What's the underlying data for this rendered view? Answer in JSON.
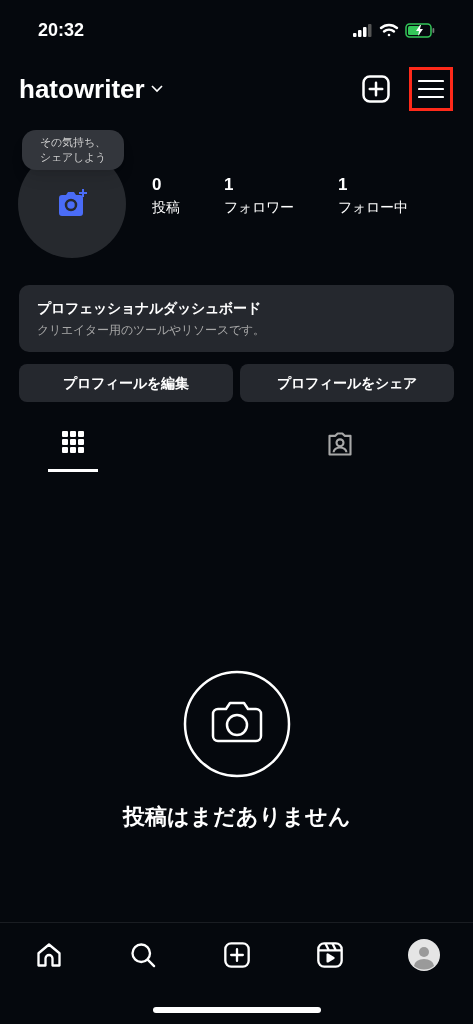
{
  "status_bar": {
    "time": "20:32"
  },
  "header": {
    "username": "hatowriter",
    "menu_highlighted": true
  },
  "profile": {
    "tooltip": [
      "その気持ち、",
      "シェアしよう"
    ],
    "stats": [
      {
        "value": "0",
        "label": "投稿"
      },
      {
        "value": "1",
        "label": "フォロワー"
      },
      {
        "value": "1",
        "label": "フォロー中"
      }
    ]
  },
  "dashboard": {
    "title": "プロフェッショナルダッシュボード",
    "subtitle": "クリエイター用のツールやリソースです。"
  },
  "buttons": [
    "プロフィールを編集",
    "プロフィールをシェア"
  ],
  "tabs": [
    {
      "kind": "grid",
      "selected": true
    },
    {
      "kind": "tagged",
      "selected": false
    }
  ],
  "empty_state": {
    "message": "投稿はまだありません"
  },
  "bottom_nav": [
    {
      "kind": "home"
    },
    {
      "kind": "search"
    },
    {
      "kind": "create"
    },
    {
      "kind": "reels"
    },
    {
      "kind": "profile"
    }
  ]
}
